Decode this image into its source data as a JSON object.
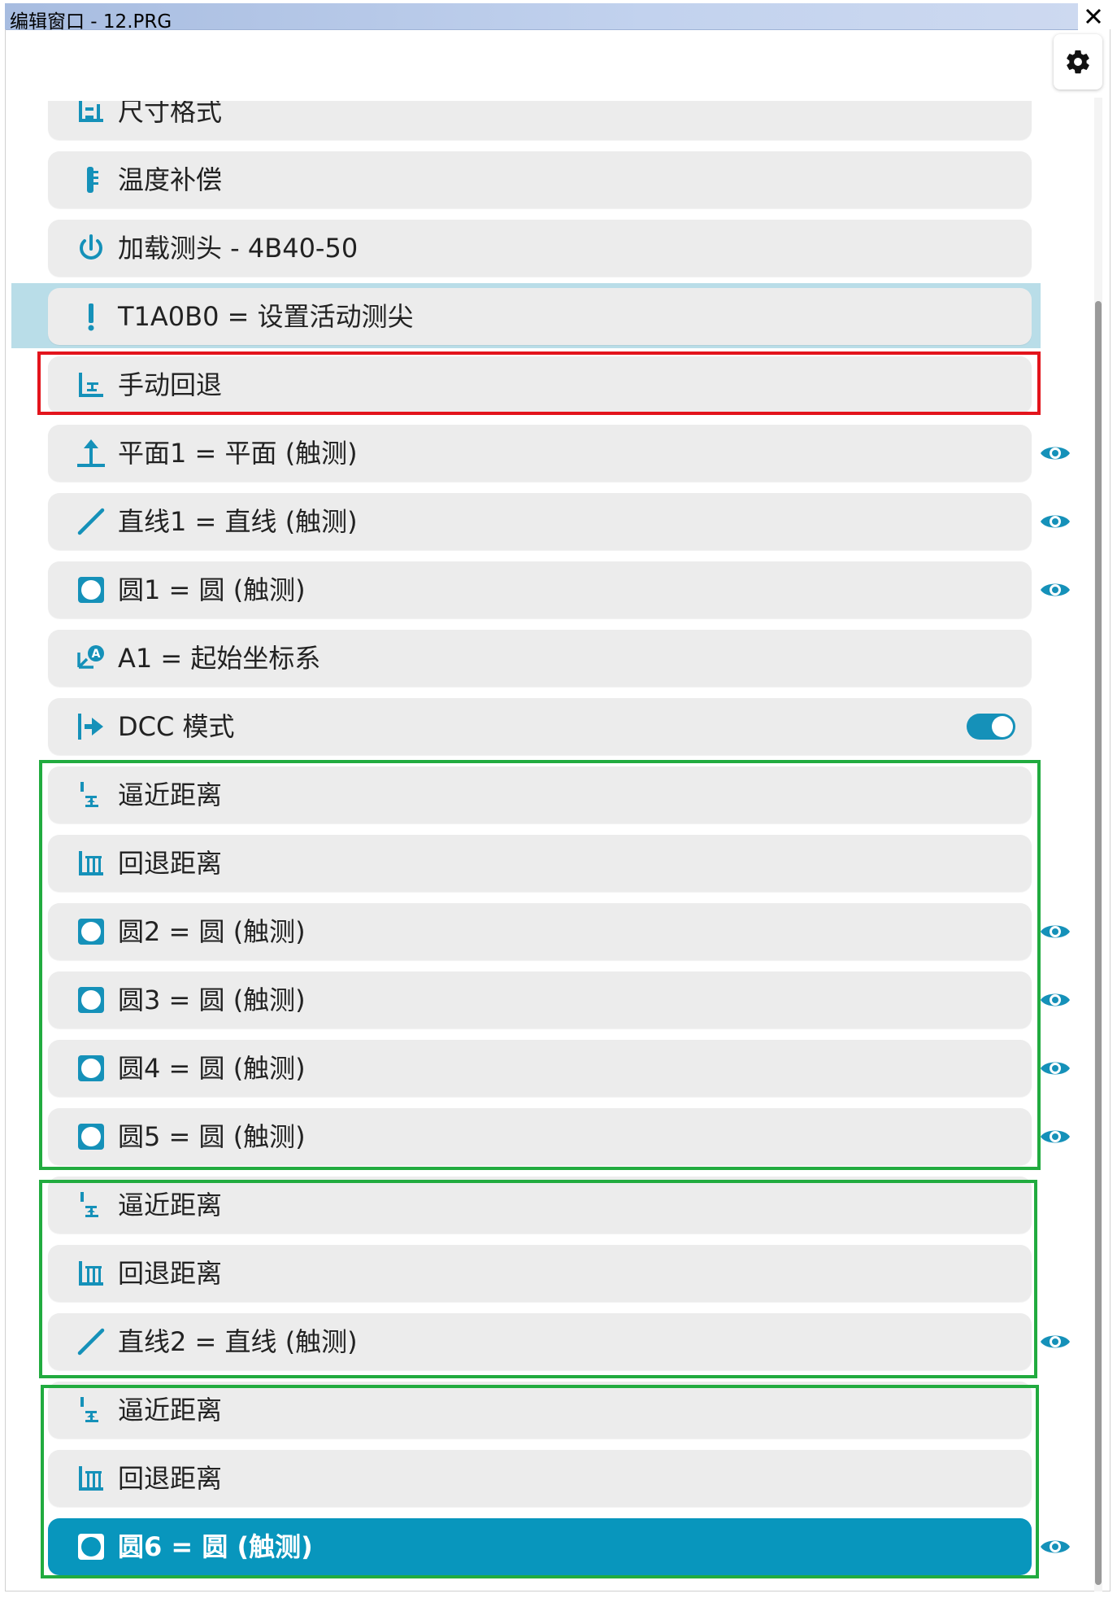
{
  "window": {
    "title": "编辑窗口 - 12.PRG"
  },
  "colors": {
    "accent": "#0896bd",
    "row_bg": "#ececec",
    "active_row_highlight": "#b9dde8",
    "annotation_red": "#e3141c",
    "annotation_green": "#21ab3f"
  },
  "items": [
    {
      "icon": "dimension-format-icon",
      "label": "尺寸格式",
      "eye": false
    },
    {
      "icon": "thermometer-icon",
      "label": "温度补偿",
      "eye": false
    },
    {
      "icon": "power-icon",
      "label": "加载测头 - 4B40-50",
      "eye": false
    },
    {
      "icon": "probe-tip-icon",
      "label": "T1A0B0 = 设置活动测尖",
      "eye": false,
      "state": "active"
    },
    {
      "icon": "retract-icon",
      "label": "手动回退",
      "eye": false
    },
    {
      "icon": "plane-icon",
      "label": "平面1 = 平面 (触测)",
      "eye": true
    },
    {
      "icon": "line-icon",
      "label": "直线1 = 直线 (触测)",
      "eye": true
    },
    {
      "icon": "circle-icon",
      "label": "圆1 = 圆 (触测)",
      "eye": true
    },
    {
      "icon": "coordinate-system-icon",
      "label": "A1 = 起始坐标系",
      "eye": false
    },
    {
      "icon": "dcc-mode-icon",
      "label": "DCC 模式",
      "eye": false,
      "toggle": true
    },
    {
      "icon": "approach-icon",
      "label": "逼近距离",
      "eye": false
    },
    {
      "icon": "retract-distance-icon",
      "label": "回退距离",
      "eye": false
    },
    {
      "icon": "circle-icon",
      "label": "圆2 = 圆 (触测)",
      "eye": true
    },
    {
      "icon": "circle-icon",
      "label": "圆3 = 圆 (触测)",
      "eye": true
    },
    {
      "icon": "circle-icon",
      "label": "圆4 = 圆 (触测)",
      "eye": true
    },
    {
      "icon": "circle-icon",
      "label": "圆5 = 圆 (触测)",
      "eye": true
    },
    {
      "icon": "approach-icon",
      "label": "逼近距离",
      "eye": false
    },
    {
      "icon": "retract-distance-icon",
      "label": "回退距离",
      "eye": false
    },
    {
      "icon": "line-icon",
      "label": "直线2 = 直线 (触测)",
      "eye": true
    },
    {
      "icon": "approach-icon",
      "label": "逼近距离",
      "eye": false
    },
    {
      "icon": "retract-distance-icon",
      "label": "回退距离",
      "eye": false
    },
    {
      "icon": "circle-icon",
      "label": "圆6 = 圆 (触测)",
      "eye": true,
      "state": "selected"
    }
  ],
  "dcc_toggle_on": true
}
